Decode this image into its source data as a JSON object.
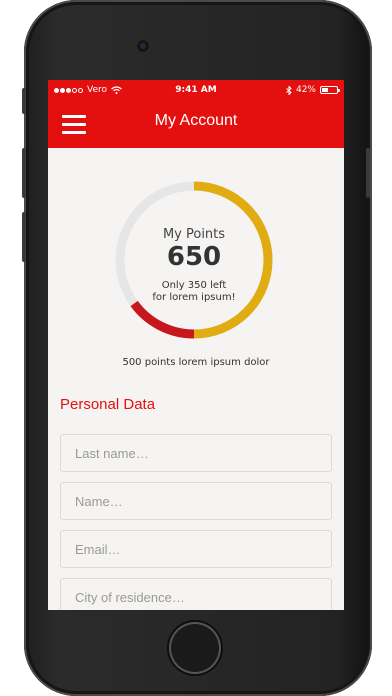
{
  "status_bar": {
    "carrier": "Vero",
    "time": "9:41 AM",
    "battery_percent": "42%",
    "battery_level": 0.42,
    "signal_bars_filled": 3,
    "signal_bars_total": 5,
    "icons": [
      "wifi-icon",
      "bluetooth-icon",
      "battery-icon"
    ]
  },
  "header": {
    "title": "My Account",
    "menu_icon": "hamburger-menu-icon"
  },
  "points": {
    "label": "My Points",
    "value": "650",
    "remaining_line1": "Only 350 left",
    "remaining_line2": "for lorem ipsum!",
    "caption": "500 points lorem ipsum dolor",
    "progress_fraction": 0.65,
    "colors": {
      "gold": "#e0ac12",
      "red": "#c8171c",
      "track": "#e6e6e6"
    }
  },
  "personal": {
    "title": "Personal Data",
    "fields": [
      {
        "placeholder": "Last name…"
      },
      {
        "placeholder": "Name…"
      },
      {
        "placeholder": "Email…"
      },
      {
        "placeholder": "City of residence…"
      }
    ]
  },
  "colors": {
    "brand": "#e3100f",
    "background": "#f5f4f2"
  }
}
